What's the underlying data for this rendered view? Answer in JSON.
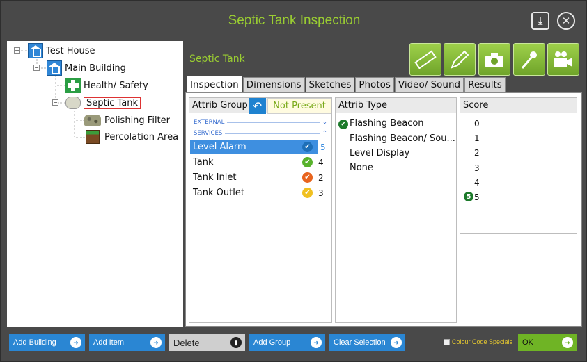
{
  "window": {
    "title": "Septic Tank Inspection"
  },
  "tree": {
    "items": [
      {
        "label": "Test House",
        "icon": "house-icon"
      },
      {
        "label": "Main Building",
        "icon": "house-icon"
      },
      {
        "label": "Health/ Safety",
        "icon": "first-aid-icon"
      },
      {
        "label": "Septic Tank",
        "icon": "septic-tank-icon"
      },
      {
        "label": "Polishing Filter",
        "icon": "gravel-icon"
      },
      {
        "label": "Percolation Area",
        "icon": "soil-icon"
      }
    ]
  },
  "section": {
    "title": "Septic Tank"
  },
  "toolbar": {
    "tools": [
      "ruler-icon",
      "pencil-icon",
      "camera-icon",
      "microphone-icon",
      "video-camera-icon"
    ]
  },
  "tabs": [
    "Inspection",
    "Dimensions",
    "Sketches",
    "Photos",
    "Video/ Sound",
    "Results"
  ],
  "attrib_group": {
    "header": "Attrib Group",
    "not_present_label": "Not Present",
    "groups": [
      {
        "label": "EXTERNAL",
        "state": "collapsed"
      },
      {
        "label": "SERVICES",
        "state": "expanded"
      }
    ],
    "items": [
      {
        "label": "Level Alarm",
        "score": "5",
        "check_color": "#1e6fb8",
        "selected": true
      },
      {
        "label": "Tank",
        "score": "4",
        "check_color": "#58b22c",
        "selected": false
      },
      {
        "label": "Tank Inlet",
        "score": "2",
        "check_color": "#e8641e",
        "selected": false
      },
      {
        "label": "Tank Outlet",
        "score": "3",
        "check_color": "#f0c020",
        "selected": false
      }
    ]
  },
  "attrib_type": {
    "header": "Attrib Type",
    "items": [
      "Flashing Beacon",
      "Flashing Beacon/ Sou...",
      "Level Display",
      "None"
    ],
    "selected_index": 0
  },
  "score": {
    "header": "Score",
    "values": [
      "0",
      "1",
      "2",
      "3",
      "4",
      "5"
    ],
    "selected_value": "5"
  },
  "bottom": {
    "add_building": "Add Building",
    "add_item": "Add Item",
    "delete": "Delete",
    "add_group": "Add Group",
    "clear_selection": "Clear Selection",
    "colour_code_specials": "Colour Code Specials",
    "ok": "OK"
  },
  "colors": {
    "accent": "#9acd32",
    "button_blue": "#2a86d3",
    "selection_blue": "#3e8fe0"
  }
}
